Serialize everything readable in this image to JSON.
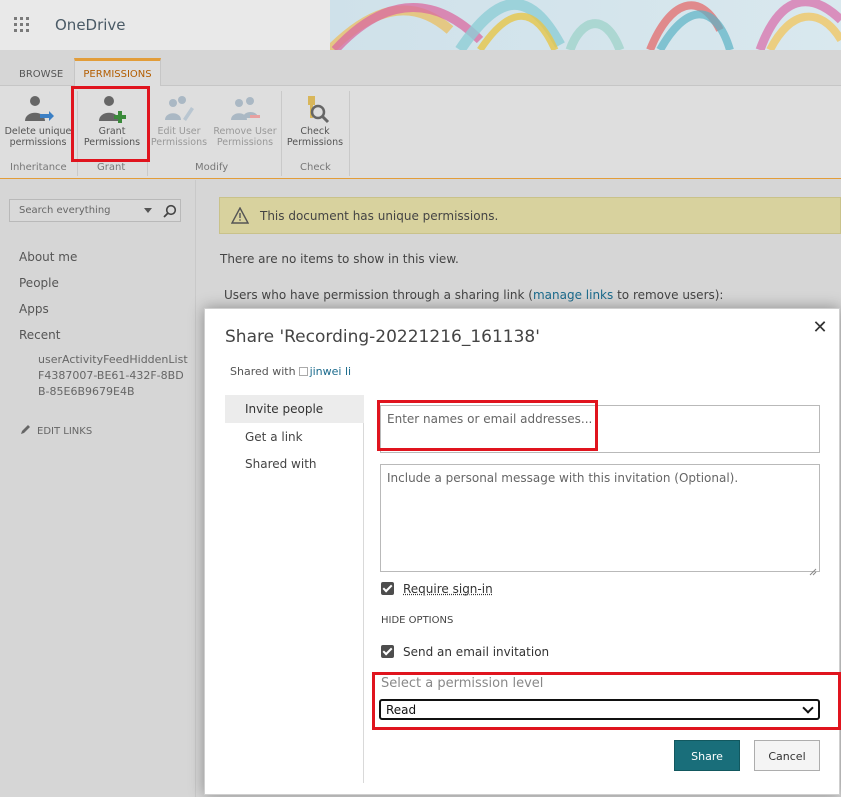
{
  "suite": {
    "brand": "OneDrive"
  },
  "ribbon": {
    "tabs": [
      "BROWSE",
      "PERMISSIONS"
    ],
    "buttons": {
      "delete_unique": [
        "Delete unique",
        "permissions"
      ],
      "grant": [
        "Grant",
        "Permissions"
      ],
      "edit_user": [
        "Edit User",
        "Permissions"
      ],
      "remove_user": [
        "Remove User",
        "Permissions"
      ],
      "check": [
        "Check",
        "Permissions"
      ]
    },
    "groups": [
      "Inheritance",
      "Grant",
      "Modify",
      "Check"
    ]
  },
  "leftnav": {
    "search_placeholder": "Search everything",
    "items": [
      "About me",
      "People",
      "Apps",
      "Recent"
    ],
    "recent_item": "userActivityFeedHiddenListF4387007-BE61-432F-8BDB-85E6B9679E4B",
    "edit_links": "EDIT LINKS"
  },
  "main": {
    "notice": "This document has unique permissions.",
    "no_items": "There are no items to show in this view.",
    "sharing_prefix": "Users who have permission through a sharing link (",
    "sharing_link": "manage links",
    "sharing_suffix": " to remove users):"
  },
  "dialog": {
    "title": "Share 'Recording-20221216_161138'",
    "shared_with_label": "Shared with",
    "shared_with_user": "jinwei li",
    "tabs": [
      "Invite people",
      "Get a link",
      "Shared with"
    ],
    "names_placeholder": "Enter names or email addresses...",
    "message_placeholder": "Include a personal message with this invitation (Optional).",
    "require_signin": "Require sign-in",
    "hide_options": "HIDE OPTIONS",
    "send_email": "Send an email invitation",
    "permission_label": "Select a permission level",
    "permission_value": "Read",
    "share_label": "Share",
    "cancel_label": "Cancel",
    "close_glyph": "✕"
  },
  "colors": {
    "accent_orange": "#e29d3a",
    "highlight_red": "#e0141e",
    "share_teal": "#196e7a",
    "link_blue": "#1a6a8c",
    "notice_yellow": "#d8d29e"
  }
}
